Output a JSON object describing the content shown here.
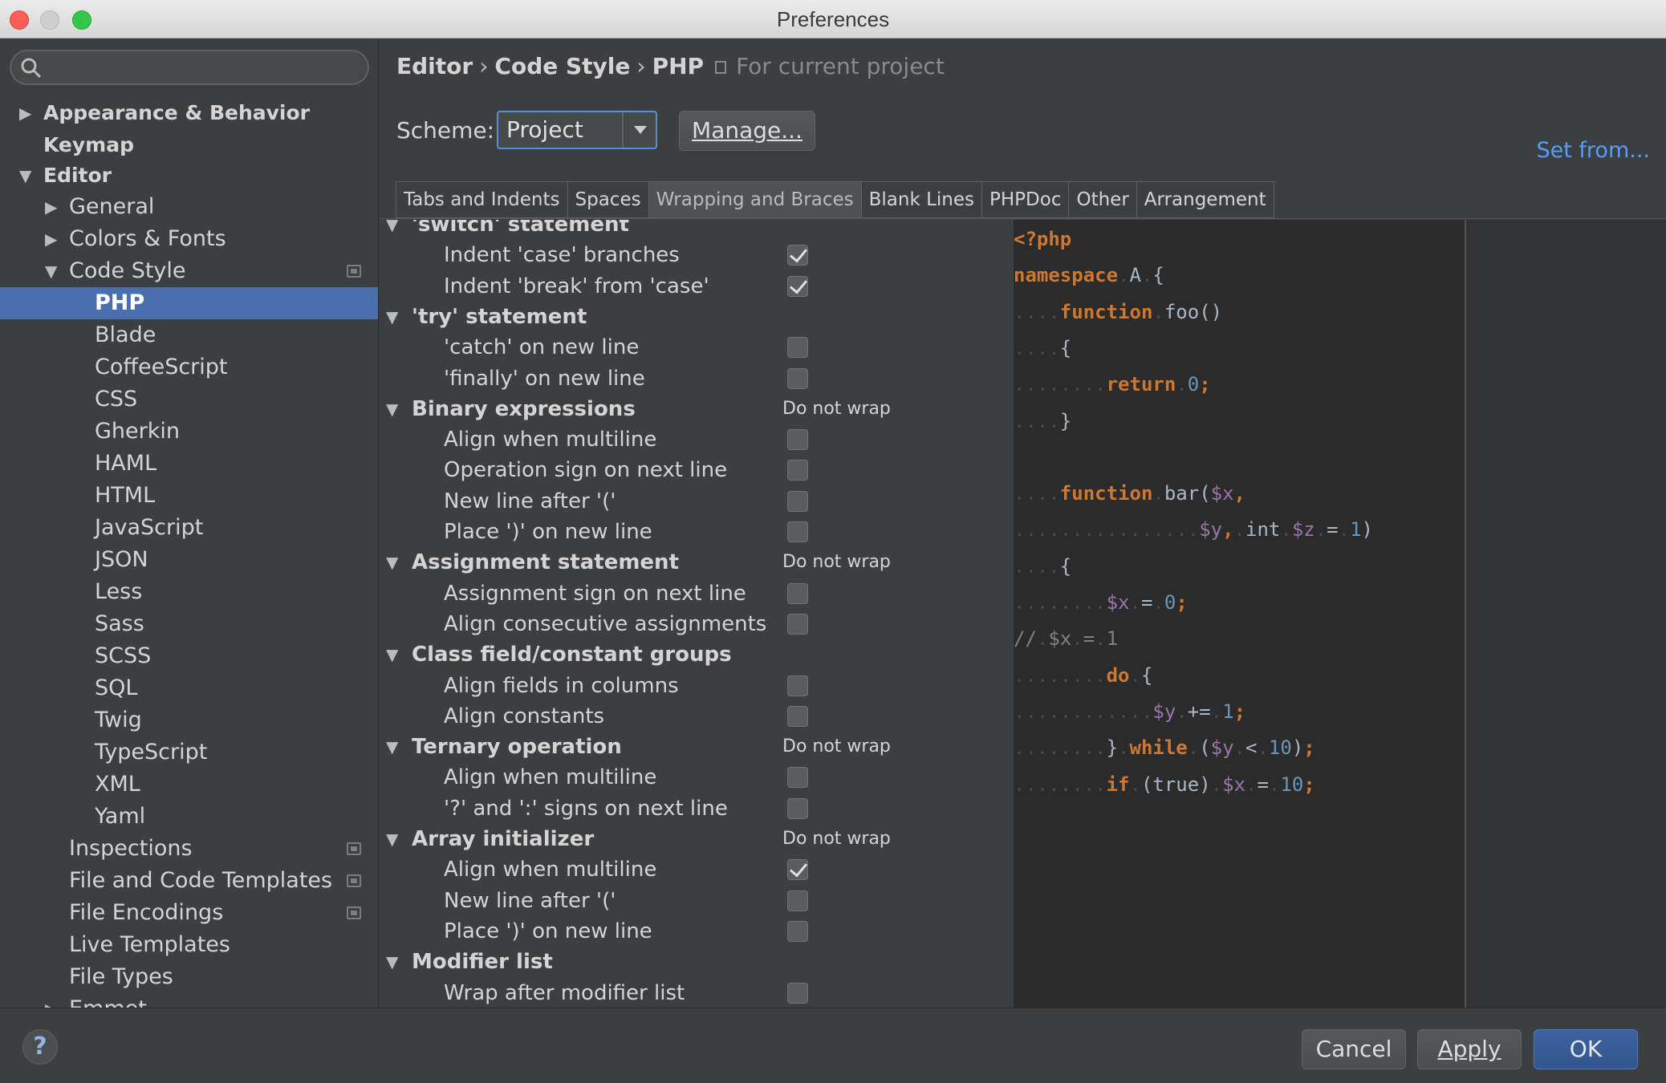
{
  "window": {
    "title": "Preferences"
  },
  "sidebar": {
    "search_placeholder": "",
    "items": [
      {
        "label": "Appearance & Behavior",
        "arrow": "▶"
      },
      {
        "label": "Keymap",
        "arrow": ""
      },
      {
        "label": "Editor",
        "arrow": "▼"
      },
      {
        "label": "General",
        "arrow": "▶"
      },
      {
        "label": "Colors & Fonts",
        "arrow": "▶"
      },
      {
        "label": "Code Style",
        "arrow": "▼"
      },
      {
        "label": "PHP"
      },
      {
        "label": "Blade"
      },
      {
        "label": "CoffeeScript"
      },
      {
        "label": "CSS"
      },
      {
        "label": "Gherkin"
      },
      {
        "label": "HAML"
      },
      {
        "label": "HTML"
      },
      {
        "label": "JavaScript"
      },
      {
        "label": "JSON"
      },
      {
        "label": "Less"
      },
      {
        "label": "Sass"
      },
      {
        "label": "SCSS"
      },
      {
        "label": "SQL"
      },
      {
        "label": "Twig"
      },
      {
        "label": "TypeScript"
      },
      {
        "label": "XML"
      },
      {
        "label": "Yaml"
      },
      {
        "label": "Inspections"
      },
      {
        "label": "File and Code Templates"
      },
      {
        "label": "File Encodings"
      },
      {
        "label": "Live Templates"
      },
      {
        "label": "File Types"
      },
      {
        "label": "Emmet",
        "arrow": "▶"
      }
    ],
    "selected": "PHP"
  },
  "breadcrumb": {
    "parts": [
      "Editor",
      "Code Style",
      "PHP"
    ],
    "separator": "›",
    "project_note": "For current project"
  },
  "scheme": {
    "label": "Scheme:",
    "value": "Project",
    "manage_label": "Manage...",
    "set_from_label": "Set from..."
  },
  "tabs": [
    {
      "label": "Tabs and Indents"
    },
    {
      "label": "Spaces"
    },
    {
      "label": "Wrapping and Braces",
      "active": true
    },
    {
      "label": "Blank Lines"
    },
    {
      "label": "PHPDoc"
    },
    {
      "label": "Other"
    },
    {
      "label": "Arrangement"
    }
  ],
  "options": [
    {
      "type": "group",
      "label": "'switch' statement"
    },
    {
      "type": "option",
      "label": "Indent 'case' branches",
      "checked": true
    },
    {
      "type": "option",
      "label": "Indent 'break' from 'case'",
      "checked": true
    },
    {
      "type": "group",
      "label": "'try' statement"
    },
    {
      "type": "option",
      "label": "'catch' on new line",
      "checked": false
    },
    {
      "type": "option",
      "label": "'finally' on new line",
      "checked": false
    },
    {
      "type": "group",
      "label": "Binary expressions",
      "wrap": "Do not wrap"
    },
    {
      "type": "option",
      "label": "Align when multiline",
      "checked": false
    },
    {
      "type": "option",
      "label": "Operation sign on next line",
      "checked": false
    },
    {
      "type": "option",
      "label": "New line after '('",
      "checked": false
    },
    {
      "type": "option",
      "label": "Place ')' on new line",
      "checked": false
    },
    {
      "type": "group",
      "label": "Assignment statement",
      "wrap": "Do not wrap"
    },
    {
      "type": "option",
      "label": "Assignment sign on next line",
      "checked": false
    },
    {
      "type": "option",
      "label": "Align consecutive assignments",
      "checked": false
    },
    {
      "type": "group",
      "label": "Class field/constant groups"
    },
    {
      "type": "option",
      "label": "Align fields in columns",
      "checked": false
    },
    {
      "type": "option",
      "label": "Align constants",
      "checked": false
    },
    {
      "type": "group",
      "label": "Ternary operation",
      "wrap": "Do not wrap"
    },
    {
      "type": "option",
      "label": "Align when multiline",
      "checked": false
    },
    {
      "type": "option",
      "label": "'?' and ':' signs on next line",
      "checked": false
    },
    {
      "type": "group",
      "label": "Array initializer",
      "wrap": "Do not wrap"
    },
    {
      "type": "option",
      "label": "Align when multiline",
      "checked": true
    },
    {
      "type": "option",
      "label": "New line after '('",
      "checked": false
    },
    {
      "type": "option",
      "label": "Place ')' on new line",
      "checked": false
    },
    {
      "type": "group",
      "label": "Modifier list"
    },
    {
      "type": "option",
      "label": "Wrap after modifier list",
      "checked": false
    }
  ],
  "preview": {
    "lines": [
      [
        [
          "kw",
          "<?php"
        ]
      ],
      [
        [
          "kw",
          "namespace"
        ],
        [
          "d",
          "."
        ],
        [
          "t",
          "A"
        ],
        [
          "d",
          "."
        ],
        [
          "t",
          "{"
        ]
      ],
      [
        [
          "d",
          "...."
        ],
        [
          "kw",
          "function"
        ],
        [
          "d",
          "."
        ],
        [
          "t",
          "foo()"
        ]
      ],
      [
        [
          "d",
          "...."
        ],
        [
          "t",
          "{"
        ]
      ],
      [
        [
          "d",
          "........"
        ],
        [
          "kw",
          "return"
        ],
        [
          "d",
          "."
        ],
        [
          "num",
          "0"
        ],
        [
          "kw",
          ";"
        ]
      ],
      [
        [
          "d",
          "...."
        ],
        [
          "t",
          "}"
        ]
      ],
      [],
      [
        [
          "d",
          "...."
        ],
        [
          "kw",
          "function"
        ],
        [
          "d",
          "."
        ],
        [
          "t",
          "bar("
        ],
        [
          "var",
          "$x"
        ],
        [
          "kw",
          ","
        ]
      ],
      [
        [
          "d",
          "................"
        ],
        [
          "var",
          "$y"
        ],
        [
          "kw",
          ","
        ],
        [
          "d",
          "."
        ],
        [
          "t",
          "int"
        ],
        [
          "d",
          "."
        ],
        [
          "var",
          "$z"
        ],
        [
          "d",
          "."
        ],
        [
          "t",
          "="
        ],
        [
          "d",
          "."
        ],
        [
          "num",
          "1"
        ],
        [
          "t",
          ")"
        ]
      ],
      [
        [
          "d",
          "...."
        ],
        [
          "t",
          "{"
        ]
      ],
      [
        [
          "d",
          "........"
        ],
        [
          "var",
          "$x"
        ],
        [
          "d",
          "."
        ],
        [
          "t",
          "="
        ],
        [
          "d",
          "."
        ],
        [
          "num",
          "0"
        ],
        [
          "kw",
          ";"
        ]
      ],
      [
        [
          "cm",
          "//"
        ],
        [
          "d",
          "."
        ],
        [
          "cm",
          "$x"
        ],
        [
          "d",
          "."
        ],
        [
          "cm",
          "="
        ],
        [
          "d",
          "."
        ],
        [
          "cm",
          "1"
        ]
      ],
      [
        [
          "d",
          "........"
        ],
        [
          "kw",
          "do"
        ],
        [
          "d",
          "."
        ],
        [
          "t",
          "{"
        ]
      ],
      [
        [
          "d",
          "............"
        ],
        [
          "var",
          "$y"
        ],
        [
          "d",
          "."
        ],
        [
          "t",
          "+="
        ],
        [
          "d",
          "."
        ],
        [
          "num",
          "1"
        ],
        [
          "kw",
          ";"
        ]
      ],
      [
        [
          "d",
          "........"
        ],
        [
          "t",
          "}"
        ],
        [
          "d",
          "."
        ],
        [
          "kw",
          "while"
        ],
        [
          "d",
          "."
        ],
        [
          "t",
          "("
        ],
        [
          "var",
          "$y"
        ],
        [
          "d",
          "."
        ],
        [
          "t",
          "<"
        ],
        [
          "d",
          "."
        ],
        [
          "num",
          "10"
        ],
        [
          "t",
          ")"
        ],
        [
          "kw",
          ";"
        ]
      ],
      [
        [
          "d",
          "........"
        ],
        [
          "kw",
          "if"
        ],
        [
          "d",
          "."
        ],
        [
          "t",
          "(true)"
        ],
        [
          "d",
          "."
        ],
        [
          "var",
          "$x"
        ],
        [
          "d",
          "."
        ],
        [
          "t",
          "="
        ],
        [
          "d",
          "."
        ],
        [
          "num",
          "10"
        ],
        [
          "kw",
          ";"
        ]
      ]
    ]
  },
  "buttons": {
    "help": "?",
    "cancel": "Cancel",
    "apply": "Apply",
    "ok": "OK"
  },
  "colors": {
    "selection": "#4b6eaf",
    "link": "#589df6",
    "keyword": "#cc7832",
    "variable": "#9876aa",
    "number": "#6897bb",
    "comment": "#808080"
  }
}
